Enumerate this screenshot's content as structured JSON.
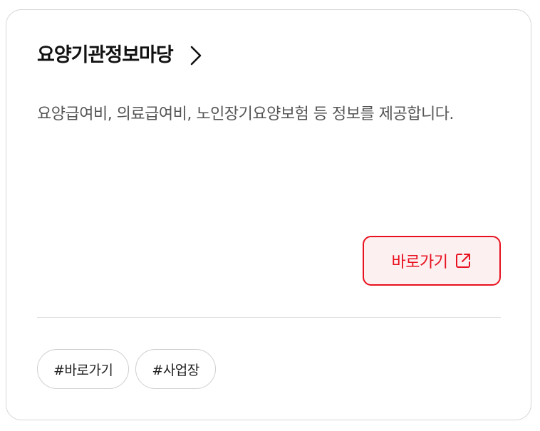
{
  "card": {
    "title": "요양기관정보마당",
    "description": "요양급여비, 의료급여비, 노인장기요양보험 등 정보를 제공합니다.",
    "go_button": {
      "label": "바로가기",
      "icon": "external-link-icon"
    },
    "title_icon": "chevron-right-icon",
    "tags": [
      {
        "label": "#바로가기"
      },
      {
        "label": "#사업장"
      }
    ],
    "colors": {
      "accent": "#e8111f",
      "accent_bg": "#fdf0f1",
      "title": "#111111",
      "description": "#555555",
      "border": "#d6d6d6"
    }
  }
}
